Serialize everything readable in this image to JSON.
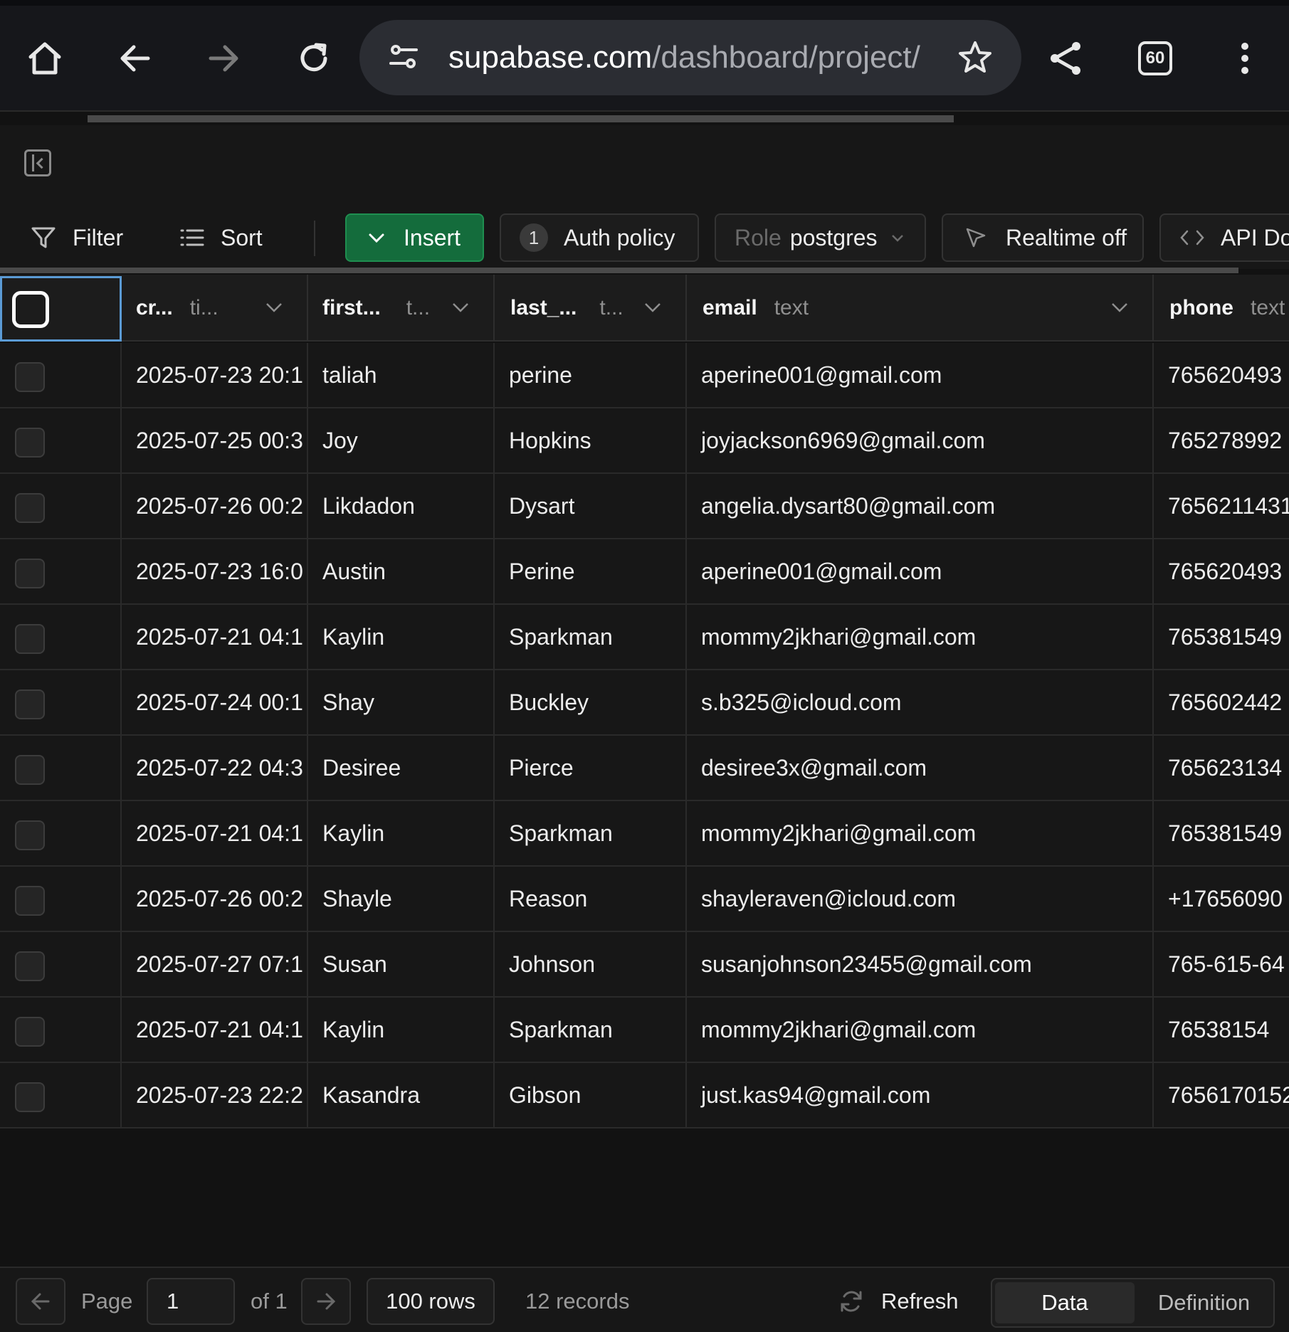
{
  "browser": {
    "url_host": "supabase.com",
    "url_path": "/dashboard/project/",
    "tab_count": "60"
  },
  "toolbar": {
    "filter_label": "Filter",
    "sort_label": "Sort",
    "insert_label": "Insert",
    "auth_policy_count": "1",
    "auth_policy_label": "Auth policy",
    "role_prefix": "Role",
    "role_value": "postgres",
    "realtime_label": "Realtime off",
    "api_docs_label": "API Do"
  },
  "columns": [
    {
      "name": "cr...",
      "type": "ti..."
    },
    {
      "name": "first...",
      "type": "t..."
    },
    {
      "name": "last_...",
      "type": "t..."
    },
    {
      "name": "email",
      "type": "text"
    },
    {
      "name": "phone",
      "type": "text"
    }
  ],
  "rows": [
    {
      "created": "2025-07-23 20:1",
      "first": "taliah",
      "last": "perine",
      "email": "aperine001@gmail.com",
      "phone": "765620493"
    },
    {
      "created": "2025-07-25 00:3",
      "first": "Joy",
      "last": "Hopkins",
      "email": "joyjackson6969@gmail.com",
      "phone": "765278992"
    },
    {
      "created": "2025-07-26 00:2",
      "first": "Likdadon",
      "last": "Dysart",
      "email": "angelia.dysart80@gmail.com",
      "phone": "7656211431"
    },
    {
      "created": "2025-07-23 16:0",
      "first": "Austin",
      "last": "Perine",
      "email": "aperine001@gmail.com",
      "phone": "765620493"
    },
    {
      "created": "2025-07-21 04:1",
      "first": "Kaylin",
      "last": "Sparkman",
      "email": "mommy2jkhari@gmail.com",
      "phone": "765381549"
    },
    {
      "created": "2025-07-24 00:1",
      "first": "Shay",
      "last": "Buckley",
      "email": "s.b325@icloud.com",
      "phone": "765602442"
    },
    {
      "created": "2025-07-22 04:3",
      "first": "Desiree",
      "last": "Pierce",
      "email": "desiree3x@gmail.com",
      "phone": "765623134"
    },
    {
      "created": "2025-07-21 04:1",
      "first": "Kaylin",
      "last": "Sparkman",
      "email": "mommy2jkhari@gmail.com",
      "phone": "765381549"
    },
    {
      "created": "2025-07-26 00:2",
      "first": "Shayle",
      "last": "Reason",
      "email": "shayleraven@icloud.com",
      "phone": "+17656090"
    },
    {
      "created": "2025-07-27 07:1",
      "first": "Susan",
      "last": "Johnson",
      "email": "susanjohnson23455@gmail.com",
      "phone": "765-615-64"
    },
    {
      "created": "2025-07-21 04:1",
      "first": "Kaylin",
      "last": "Sparkman",
      "email": "mommy2jkhari@gmail.com",
      "phone": "76538154"
    },
    {
      "created": "2025-07-23 22:2",
      "first": "Kasandra",
      "last": "Gibson",
      "email": "just.kas94@gmail.com",
      "phone": "7656170152"
    }
  ],
  "footer": {
    "page_label": "Page",
    "page_value": "1",
    "of_label": "of 1",
    "rows_label": "100 rows",
    "records_label": "12 records",
    "refresh_label": "Refresh",
    "data_tab": "Data",
    "definition_tab": "Definition"
  },
  "colors": {
    "accent_green": "#146c3c",
    "selection_blue": "#5b9bd5",
    "background": "#121212"
  }
}
